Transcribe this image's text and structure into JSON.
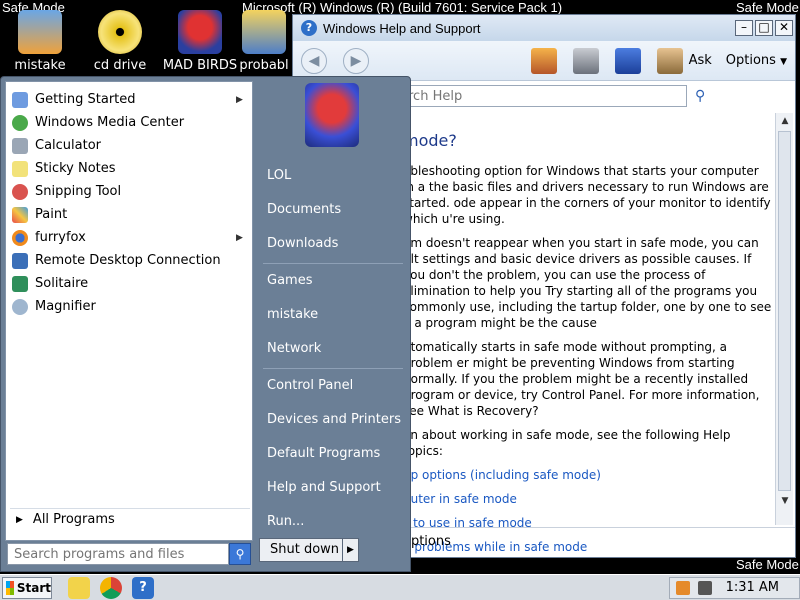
{
  "desktop": {
    "safe_mode_label": "Safe Mode",
    "title_overlay": "Microsoft (R) Windows (R) (Build 7601: Service Pack 1)",
    "icons": [
      {
        "label": "mistake"
      },
      {
        "label": "cd drive"
      },
      {
        "label": "MAD BIRDS"
      },
      {
        "label": "probabl"
      }
    ]
  },
  "help_window": {
    "title": "Windows Help and Support",
    "toolbar": {
      "ask_label": "Ask",
      "options_label": "Options"
    },
    "search_placeholder": "rch Help",
    "heading": "mode?",
    "paragraphs": [
      "ableshooting option for Windows that starts your computer in a the basic files and drivers necessary to run Windows are started. ode appear in the corners of your monitor to identify which u're using.",
      "em doesn't reappear when you start in safe mode, you can ult settings and basic device drivers as possible causes. If you don't the problem, you can use the process of elimination to help you Try starting all of the programs you commonly use, including the tartup folder, one by one to see if a program might be the cause",
      "utomatically starts in safe mode without prompting, a problem er might be preventing Windows from starting normally. If you the problem might be a recently installed program or device, try Control Panel. For more information, see What is Recovery?",
      "on about working in safe mode, see the following Help topics:"
    ],
    "links": [
      "up options (including safe mode)",
      "puter in safe mode",
      "s to use in safe mode",
      "g problems while in safe mode"
    ],
    "status_text": "options"
  },
  "start_menu": {
    "left_items": [
      {
        "label": "Getting Started",
        "submenu": true
      },
      {
        "label": "Windows Media Center",
        "submenu": false
      },
      {
        "label": "Calculator",
        "submenu": false
      },
      {
        "label": "Sticky Notes",
        "submenu": false
      },
      {
        "label": "Snipping Tool",
        "submenu": false
      },
      {
        "label": "Paint",
        "submenu": false
      },
      {
        "label": "furryfox",
        "submenu": true
      },
      {
        "label": "Remote Desktop Connection",
        "submenu": false
      },
      {
        "label": "Solitaire",
        "submenu": false
      },
      {
        "label": "Magnifier",
        "submenu": false
      }
    ],
    "all_programs_label": "All Programs",
    "search_placeholder": "Search programs and files",
    "right_items": [
      {
        "label": "LOL"
      },
      {
        "label": "Documents"
      },
      {
        "label": "Downloads"
      },
      {
        "label": "Games"
      },
      {
        "label": "mistake"
      },
      {
        "label": "Network"
      },
      {
        "label": "Control Panel"
      },
      {
        "label": "Devices and Printers"
      },
      {
        "label": "Default Programs"
      },
      {
        "label": "Help and Support"
      },
      {
        "label": "Run..."
      }
    ],
    "shutdown_label": "Shut down"
  },
  "taskbar": {
    "start_label": "Start",
    "clock": "1:31 AM"
  }
}
